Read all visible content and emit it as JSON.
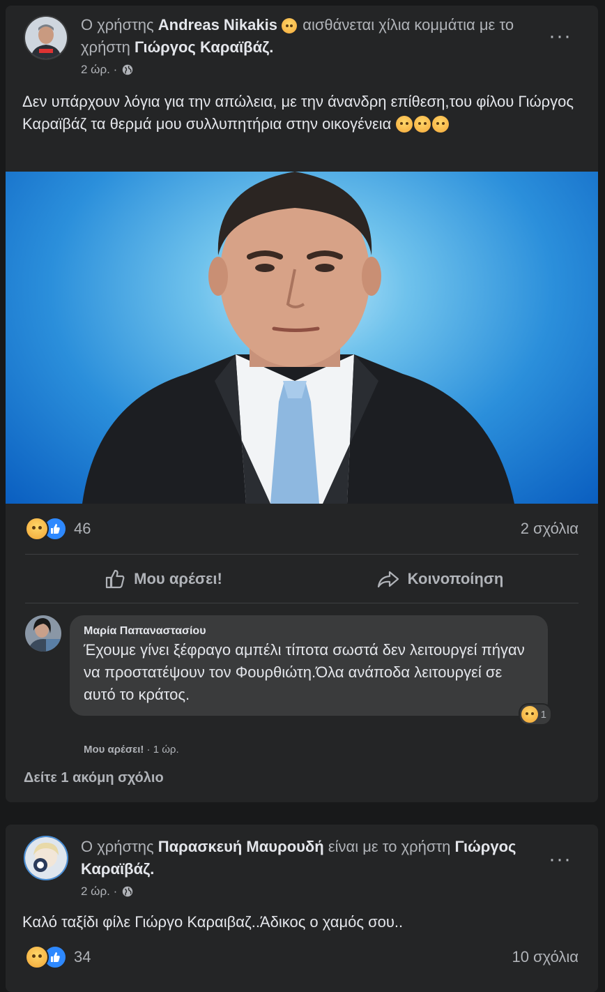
{
  "post1": {
    "header_prefix": "Ο χρήστης",
    "author": "Andreas Nikakis",
    "feeling_text": "αισθάνεται χίλια κομμάτια με το χρήστη",
    "tagged": "Γιώργος Καραϊβάζ.",
    "time": "2 ώρ. ·",
    "text": "Δεν υπάρχουν λόγια για την απώλεια, με την άνανδρη επίθεση,του φίλου Γιώργος Καραϊβάζ τα θερμά μου συλλυπητήρια στην οικογένεια",
    "reaction_count": "46",
    "comments_count": "2 σχόλια",
    "like_label": "Μου αρέσει!",
    "share_label": "Κοινοποίηση",
    "comment": {
      "author": "Μαρία Παπαναστασίου",
      "text": "Έχουμε γίνει ξέφραγο αμπέλι τίποτα σωστά δεν λειτουργεί πήγαν να προστατέψουν τον Φουρθιώτη.Όλα ανάποδα λειτουργεί σε αυτό το κράτος.",
      "reaction_count": "1",
      "like_label": "Μου αρέσει!",
      "time": "· 1 ώρ."
    },
    "more_comments": "Δείτε 1 ακόμη σχόλιο"
  },
  "post2": {
    "header_prefix": "Ο χρήστης",
    "author": "Παρασκευή Μαυρουδή",
    "with_text": "είναι με το χρήστη",
    "tagged": "Γιώργος Καραϊβάζ.",
    "time": "2 ώρ. ·",
    "text": "Καλό ταξίδι φίλε Γιώργο Καραιβαζ..Άδικος ο χαμός σου..",
    "reaction_count": "34",
    "comments_count": "10 σχόλια"
  },
  "colors": {
    "background": "#18191a",
    "card": "#242526",
    "bubble": "#3a3b3c",
    "like_blue": "#2e89ff",
    "sad_yellow": "#f2a535"
  },
  "icons": [
    "globe-icon",
    "more-icon",
    "like-icon",
    "share-icon",
    "sad-reaction-icon",
    "like-reaction-icon"
  ]
}
